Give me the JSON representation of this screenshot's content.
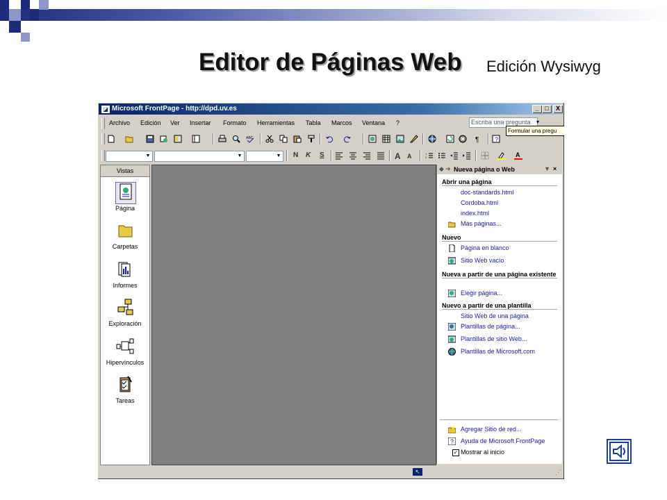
{
  "slide": {
    "title": "Editor de Páginas Web",
    "subtitle": "Edición Wysiwyg"
  },
  "window": {
    "title": "Microsoft FrontPage - http://dpd.uv.es",
    "minimize": "_",
    "maximize": "□",
    "close": "X"
  },
  "menu": {
    "items": [
      "Archivo",
      "Edición",
      "Ver",
      "Insertar",
      "Formato",
      "Herramientas",
      "Tabla",
      "Marcos",
      "Ventana",
      "?"
    ],
    "ask_placeholder": "Escriba una pregunta",
    "tooltip": "Formular una pregu",
    "close": "×"
  },
  "formatting": {
    "bold": "N",
    "italic": "K",
    "underline": "S",
    "font_grow": "A",
    "font_shrink": "A"
  },
  "views": {
    "header": "Vistas",
    "items": [
      {
        "label": "Página",
        "icon": "page-view-icon"
      },
      {
        "label": "Carpetas",
        "icon": "folder-icon"
      },
      {
        "label": "Informes",
        "icon": "reports-icon"
      },
      {
        "label": "Exploración",
        "icon": "navigation-icon"
      },
      {
        "label": "Hipervínculos",
        "icon": "hyperlinks-icon"
      },
      {
        "label": "Tareas",
        "icon": "tasks-icon"
      }
    ]
  },
  "task_pane": {
    "title": "Nueva página o Web",
    "sections": {
      "open": "Abrir una página",
      "new": "Nuevo",
      "from_existing": "Nueva a partir de una página existente",
      "from_template": "Nuevo a partir de una plantilla"
    },
    "open_links": [
      "doc-standards.html",
      "Cordoba.html",
      "index.html",
      "Más páginas..."
    ],
    "new_links": [
      "Página en blanco",
      "Sitio Web vacío"
    ],
    "existing_links": [
      "Elegir página..."
    ],
    "template_links": [
      "Sitio Web de una página",
      "Plantillas de página...",
      "Plantillas de sitio Web...",
      "Plantillas de Microsoft.com"
    ],
    "footer_links": [
      "Agregar Sitio de red...",
      "Ayuda de Microsoft FrontPage"
    ],
    "show_at_start": "Mostrar al inicio",
    "show_at_start_checked": true
  },
  "colors": {
    "title_bar": "#0a246a",
    "link": "#1a1aa6",
    "editor_bg": "#808080"
  }
}
